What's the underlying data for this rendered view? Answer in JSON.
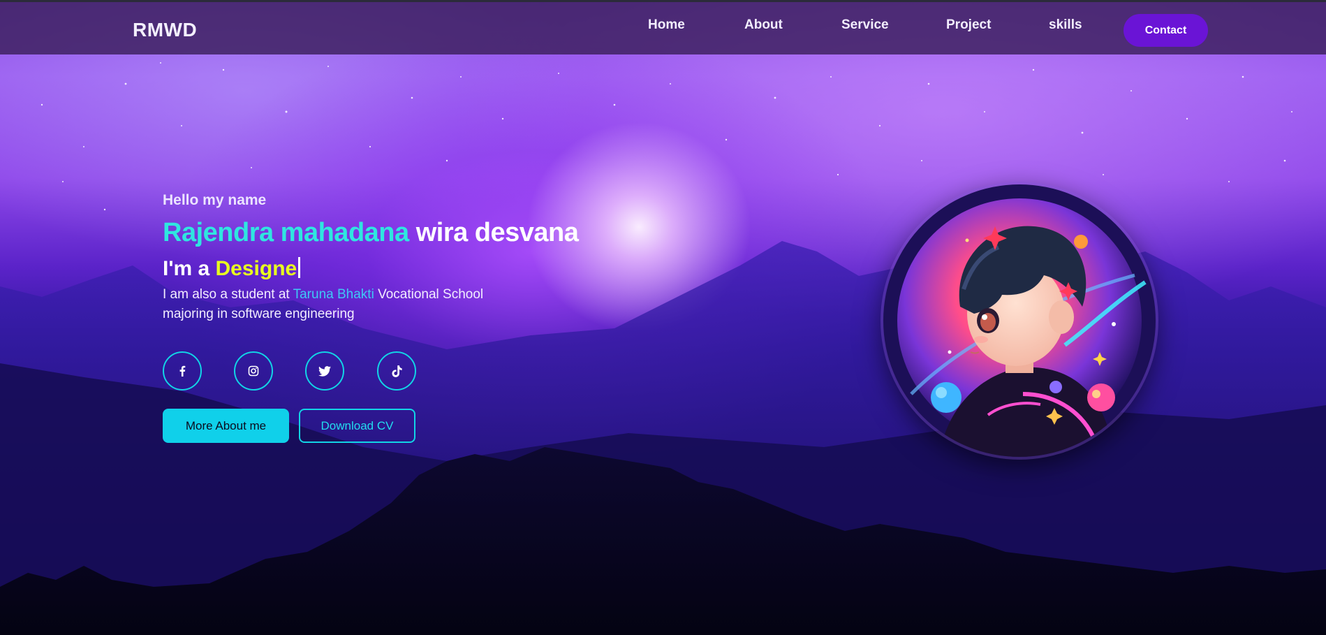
{
  "nav": {
    "logo": "RMWD",
    "links": [
      "Home",
      "About",
      "Service",
      "Project",
      "skills"
    ],
    "contact_label": "Contact"
  },
  "hero": {
    "greeting": "Hello my name",
    "name_first": "Rajendra mahadana",
    "name_rest": " wira desvana",
    "role_prefix": "I'm a ",
    "role_word": "Designe",
    "desc_before": "I am also a student at ",
    "desc_school": "Taruna Bhakti",
    "desc_after": " Vocational School majoring in software engineering",
    "socials": [
      "facebook-icon",
      "instagram-icon",
      "twitter-icon",
      "tiktok-icon"
    ],
    "primary_button": "More About me",
    "secondary_button": "Download CV"
  },
  "colors": {
    "accent_cyan": "#10d0ea",
    "name_highlight": "#2fe6e0",
    "role_highlight": "#e8ff1f",
    "school_highlight": "#3fc8f5",
    "contact_button": "#6a14d6",
    "navbar": "#3a1e5c"
  }
}
